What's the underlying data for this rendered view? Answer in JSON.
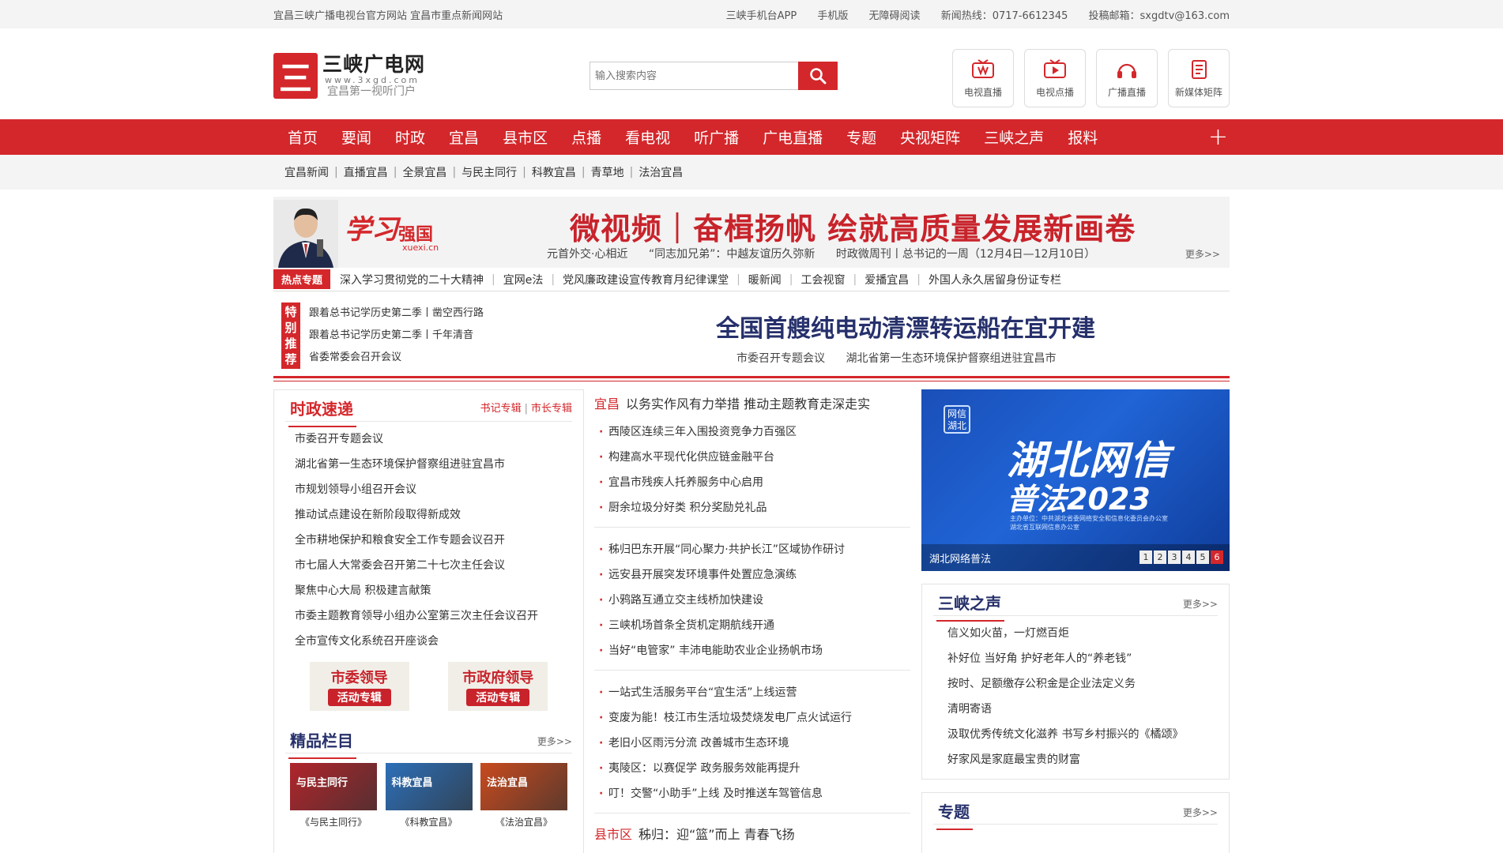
{
  "topbar": {
    "left": "宜昌三峡广播电视台官方网站 宜昌市重点新闻网站",
    "links": [
      "三峡手机台APP",
      "手机版",
      "无障碍阅读",
      "新闻热线：0717-6612345",
      "投稿邮箱：sxgdtv@163.com"
    ]
  },
  "logo": {
    "mark": "三",
    "name": "三峡广电网",
    "domain": "www.3xgd.com",
    "slogan": "宜昌第一视听门户"
  },
  "search": {
    "placeholder": "输入搜索内容"
  },
  "quick": [
    "电视直播",
    "电视点播",
    "广播直播",
    "新媒体矩阵"
  ],
  "nav": [
    "首页",
    "要闻",
    "时政",
    "宜昌",
    "县市区",
    "点播",
    "看电视",
    "听广播",
    "广电直播",
    "专题",
    "央视矩阵",
    "三峡之声",
    "报料"
  ],
  "nav_plus": "+",
  "subnav": [
    "宜昌新闻",
    "直播宜昌",
    "全景宜昌",
    "与民主同行",
    "科教宜昌",
    "青草地",
    "法治宜昌"
  ],
  "banner": {
    "xuexi": "学习",
    "qiangguo": "强国",
    "url": "xuexi.cn",
    "title": "微视频｜奋楫扬帆 绘就高质量发展新画卷",
    "subs": [
      "元首外交·心相近",
      "“同志加兄弟”：中越友谊历久弥新",
      "时政微周刊丨总书记的一周（12月4日—12月10日）"
    ],
    "more": "更多>>"
  },
  "hot": {
    "tag": "热点专题",
    "items": [
      "深入学习贯彻党的二十大精神",
      "宜网e法",
      "党风廉政建设宣传教育月纪律课堂",
      "暖新闻",
      "工会视窗",
      "爱播宜昌",
      "外国人永久居留身份证专栏"
    ]
  },
  "special": {
    "tag": "特别推荐",
    "list": [
      "跟着总书记学历史第二季丨凿空西行路",
      "跟着总书记学历史第二季丨千年清音",
      "省委常委会召开会议"
    ],
    "headline": "全国首艘纯电动清漂转运船在宜开建",
    "subs": [
      "市委召开专题会议",
      "湖北省第一生态环境保护督察组进驻宜昌市"
    ]
  },
  "left": {
    "title": "时政速递",
    "links": [
      "书记专辑",
      "市长专辑"
    ],
    "items": [
      "市委召开专题会议",
      "湖北省第一生态环境保护督察组进驻宜昌市",
      "市规划领导小组召开会议",
      "推动试点建设在新阶段取得新成效",
      "全市耕地保护和粮食安全工作专题会议召开",
      "市七届人大常委会召开第二十七次主任会议",
      "聚焦中心大局 积极建言献策",
      "市委主题教育领导小组办公室第三次主任会议召开",
      "全市宣传文化系统召开座谈会"
    ],
    "leaders": [
      {
        "a": "市委领导",
        "b": "活动专辑"
      },
      {
        "a": "市政府领导",
        "b": "活动专辑"
      }
    ],
    "jingpin_title": "精品栏目",
    "jingpin_more": "更多>>",
    "thumbs": [
      {
        "img": "与民主同行",
        "cap": "《与民主同行》",
        "color": "#b0252b"
      },
      {
        "img": "科教宜昌",
        "cap": "《科教宜昌》",
        "color": "#2c6fb8"
      },
      {
        "img": "法治宜昌",
        "cap": "《法治宜昌》",
        "color": "#c84a1e"
      }
    ]
  },
  "mid": {
    "g1_cat": "宜昌",
    "g1_head": "以务实作风有力举措 推动主题教育走深走实",
    "g1": [
      "西陵区连续三年入围投资竞争力百强区",
      "构建高水平现代化供应链金融平台",
      "宜昌市残疾人托养服务中心启用",
      "厨余垃圾分好类 积分奖励兑礼品"
    ],
    "g2": [
      "秭归巴东开展“同心聚力·共护长江”区域协作研讨",
      "远安县开展突发环境事件处置应急演练",
      "小鸦路互通立交主线桥加快建设",
      "三峡机场首条全货机定期航线开通",
      "当好“电管家” 丰沛电能助农业企业扬帆市场"
    ],
    "g3": [
      "一站式生活服务平台“宜生活”上线运营",
      "变废为能！枝江市生活垃圾焚烧发电厂点火试运行",
      "老旧小区雨污分流 改善城市生态环境",
      "夷陵区：以赛促学 政务服务效能再提升",
      "叮！交警“小助手”上线 及时推送车驾管信息"
    ],
    "g4_cat": "县市区",
    "g4_head": "秭归：迎“篮”而上 青春飞扬"
  },
  "right": {
    "promo": {
      "badge": "网信湖北",
      "big1": "湖北网信",
      "big2": "普法2023",
      "small": "主办单位：中共湖北省委网络安全和信息化委员会办公室\n湖北省互联网信息办公室",
      "caption": "湖北网络普法",
      "pages": [
        "1",
        "2",
        "3",
        "4",
        "5",
        "6"
      ],
      "active_page": "6"
    },
    "voice_title": "三峡之声",
    "voice_more": "更多>>",
    "voice": [
      "信义如火苗，一灯燃百炬",
      "补好位 当好角 护好老年人的“养老钱”",
      "按时、足额缴存公积金是企业法定义务",
      "清明寄语",
      "汲取优秀传统文化滋养 书写乡村振兴的《橘颂》",
      "好家风是家庭最宝贵的财富"
    ],
    "topic_title": "专题",
    "topic_more": "更多>>"
  },
  "colors": {
    "brand_red": "#d4272b",
    "headline_navy": "#26306b"
  }
}
